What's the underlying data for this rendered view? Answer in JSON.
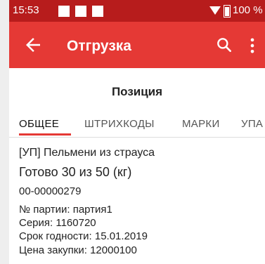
{
  "status_bar": {
    "time": "15:53",
    "battery_percent": "100 %",
    "notification_icons": [
      "notification-icon",
      "notification-icon",
      "notification-icon"
    ]
  },
  "app_bar": {
    "title": "Отгрузка",
    "icons": {
      "back": "back-arrow-icon",
      "search": "search-icon",
      "more": "more-vert-icon"
    },
    "color": "#e53935"
  },
  "subheader": {
    "title": "Позиция"
  },
  "tabs": [
    {
      "label": "ОБЩЕЕ",
      "active": true
    },
    {
      "label": "ШТРИХКОДЫ",
      "active": false
    },
    {
      "label": "МАРКИ",
      "active": false
    },
    {
      "label": "УПА",
      "active": false
    }
  ],
  "details": {
    "name": "[УП] Пельмени из страуса",
    "progress": "Готово 30 из 50 (кг)",
    "code": "00-00000279",
    "batch": "№ партии: партия1",
    "series": "Серия: 1160720",
    "expiry": "Срок годности: 15.01.2019",
    "price": "Цена закупки: 12000100"
  },
  "colors": {
    "status_bar": "#b71c1c",
    "app_bar": "#e53935",
    "accent": "#e53935"
  }
}
